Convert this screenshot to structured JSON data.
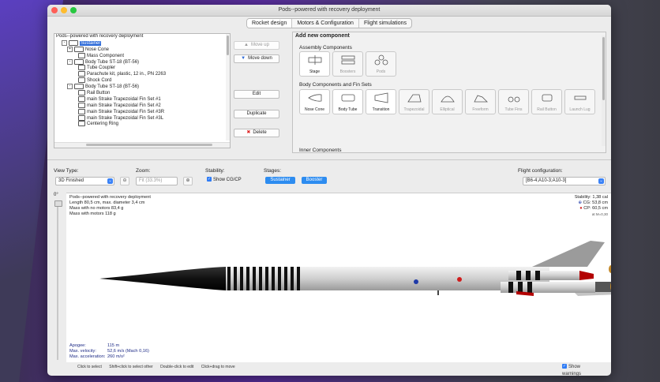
{
  "window": {
    "title": "Pods--powered with recovery deployment"
  },
  "tabs": [
    {
      "label": "Rocket design",
      "active": true
    },
    {
      "label": "Motors & Configuration",
      "active": false
    },
    {
      "label": "Flight simulations",
      "active": false
    }
  ],
  "tree": {
    "items": [
      {
        "label": "Pods--powered with recovery deployment",
        "indent": 0,
        "icon": "none",
        "selected": false
      },
      {
        "label": "Sustainer",
        "indent": 1,
        "icon": "rocket-icon",
        "selected": true,
        "expander": "-"
      },
      {
        "label": "Nose Cone",
        "indent": 2,
        "icon": "nose-cone-icon",
        "expander": "+"
      },
      {
        "label": "Mass Component",
        "indent": 4,
        "icon": "mass-icon"
      },
      {
        "label": "Body Tube ST-18 (BT-56)",
        "indent": 2,
        "icon": "body-tube-icon",
        "expander": "-"
      },
      {
        "label": "Tube Coupler",
        "indent": 4,
        "icon": "coupler-icon"
      },
      {
        "label": "Parachute kit, plastic, 12 in., PN 2263",
        "indent": 4,
        "icon": "parachute-icon"
      },
      {
        "label": "Shock Cord",
        "indent": 4,
        "icon": "shock-cord-icon"
      },
      {
        "label": "Body Tube ST-18 (BT-56)",
        "indent": 2,
        "icon": "body-tube-icon",
        "expander": "-"
      },
      {
        "label": "Rail Button",
        "indent": 4,
        "icon": "rail-button-icon"
      },
      {
        "label": "main Strake Trapezoidal Fin Set #1",
        "indent": 4,
        "icon": "fin-icon"
      },
      {
        "label": "main Strake Trapezoidal Fin Set #2",
        "indent": 4,
        "icon": "fin-icon"
      },
      {
        "label": "main Strake Trapezoidal Fin Set #3R",
        "indent": 4,
        "icon": "fin-icon"
      },
      {
        "label": "main Strake Trapezoidal Fin Set #3L",
        "indent": 4,
        "icon": "fin-icon"
      },
      {
        "label": "Centering Ring",
        "indent": 4,
        "icon": "ring-icon"
      }
    ]
  },
  "buttons": {
    "move_up": "Move up",
    "move_down": "Move down",
    "edit": "Edit",
    "duplicate": "Duplicate",
    "delete": "Delete"
  },
  "add_panel": {
    "title": "Add new component",
    "assembly_title": "Assembly Components",
    "assembly": [
      {
        "label": "Stage",
        "enabled": true
      },
      {
        "label": "Boosters",
        "enabled": false
      },
      {
        "label": "Pods",
        "enabled": false
      }
    ],
    "body_title": "Body Components and Fin Sets",
    "body": [
      {
        "label": "Nose Cone",
        "enabled": true
      },
      {
        "label": "Body Tube",
        "enabled": true
      },
      {
        "label": "Transition",
        "enabled": true
      },
      {
        "label": "Trapezoidal",
        "enabled": false
      },
      {
        "label": "Elliptical",
        "enabled": false
      },
      {
        "label": "Freeform",
        "enabled": false
      },
      {
        "label": "Tube Fins",
        "enabled": false
      },
      {
        "label": "Rail Button",
        "enabled": false
      },
      {
        "label": "Launch Lug",
        "enabled": false
      }
    ],
    "inner_title": "Inner Components"
  },
  "controls": {
    "view_type_label": "View Type:",
    "view_type_value": "3D Finished",
    "zoom_label": "Zoom:",
    "zoom_value": "Fit (33.3%)",
    "stability_label": "Stability:",
    "show_cgcp": "Show CG/CP",
    "stages_label": "Stages:",
    "stage_buttons": [
      "Sustainer",
      "Booster"
    ],
    "flight_config_label": "Flight configuration:",
    "flight_config_value": "[B6-4;A10-3;A10-3]"
  },
  "view": {
    "rotation": "0°",
    "title": "Pods--powered with recovery deployment",
    "length_line": "Length 80,5 cm, max. diameter 3,4 cm",
    "mass_no_motors": "Mass with no motors 83,4 g",
    "mass_with_motors": "Mass with motors 118 g",
    "stability": "Stability: 1,38 cal",
    "cg": "CG: 53,8 cm",
    "cp": "CP: 60,5 cm",
    "mach": "at M=0,30",
    "apogee_label": "Apogee:",
    "apogee_value": "115 m",
    "max_velocity_label": "Max. velocity:",
    "max_velocity_value": "52,6 m/s  (Mach 0,16)",
    "max_accel_label": "Max. acceleration:",
    "max_accel_value": "260 m/s²"
  },
  "footer": {
    "hints": [
      "Click to select",
      "Shift+click to select other",
      "Double-click to edit",
      "Click+drag to move"
    ],
    "show_warnings": "Show warnings"
  }
}
